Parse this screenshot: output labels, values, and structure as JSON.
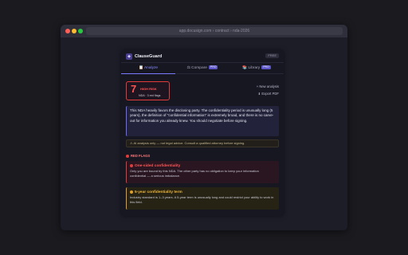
{
  "browser": {
    "url": "app.docusign.com › contract › nda-2026"
  },
  "panel": {
    "brand": "ClauseGuard",
    "badge": "FREE",
    "tabs": [
      {
        "label": "📋 Analyze",
        "active": true
      },
      {
        "label": "⚖ Compare",
        "pro": "PRO"
      },
      {
        "label": "📚 Library",
        "pro": "PRO"
      }
    ],
    "risk": {
      "score": "7",
      "label": "HIGH RISK",
      "sub": "NDA · 3 red flags"
    },
    "actions": {
      "new": "+ New analysis",
      "export": "⬇ Export PDF"
    },
    "summary": "This NDA heavily favors the disclosing party. The confidentiality period is unusually long (5 years), the definition of \"confidential information\" is extremely broad, and there is no carve-out for information you already knew. You should negotiate before signing.",
    "disclaimer": "⚠ AI analysis only — not legal advice. Consult a qualified attorney before signing.",
    "red_flags_header": "RED FLAGS",
    "flags": [
      {
        "title": "One-sided confidentiality",
        "desc": "Only you are bound by this NDA. The other party has no obligation to keep your information confidential — a serious imbalance.",
        "color": "#e23b3b"
      },
      {
        "title": "5-year confidentiality term",
        "desc": "Industry standard is 1–3 years. A 5-year term is unusually long and could restrict your ability to work in this field.",
        "color": "#e0a020"
      }
    ]
  }
}
